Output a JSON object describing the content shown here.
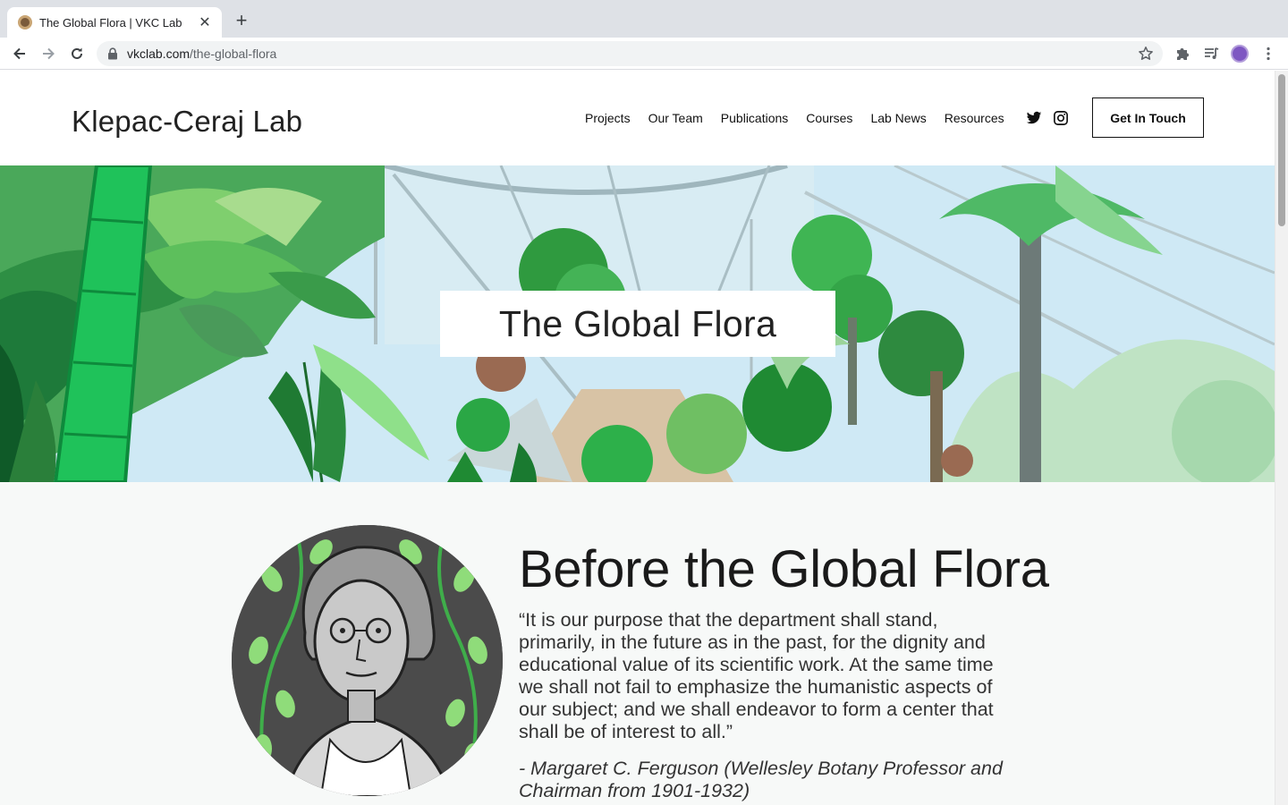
{
  "browser": {
    "tab_title": "The Global Flora | VKC Lab",
    "url_host": "vkclab.com",
    "url_path": "/the-global-flora"
  },
  "site": {
    "logo": "Klepac-Ceraj Lab",
    "nav": [
      "Projects",
      "Our Team",
      "Publications",
      "Courses",
      "Lab News",
      "Resources"
    ],
    "cta_label": "Get In Touch"
  },
  "hero": {
    "title": "The Global Flora"
  },
  "section": {
    "title": "Before the Global Flora",
    "quote": "“It is our purpose that the department shall stand, primarily, in the future as in the past, for the dignity and educational value of its scientific work. At the same time we shall not fail to emphasize the humanistic aspects of our subject; and we shall endeavor to form a center that shall be of interest to all.”",
    "attribution": "- Margaret C. Ferguson (Wellesley Botany Professor and Chairman from 1901-1932)"
  },
  "icons": {
    "back": "arrow-left-icon",
    "forward": "arrow-right-icon",
    "reload": "reload-icon",
    "lock": "lock-icon",
    "bookmark": "star-icon",
    "extensions": "puzzle-icon",
    "media": "media-queue-icon",
    "menu": "kebab-menu-icon",
    "twitter": "twitter-icon",
    "instagram": "instagram-icon"
  },
  "colors": {
    "chrome_tabstrip": "#dee1e6",
    "content_bg": "#f7f9f8",
    "hero_green": "#2e9e3e"
  }
}
